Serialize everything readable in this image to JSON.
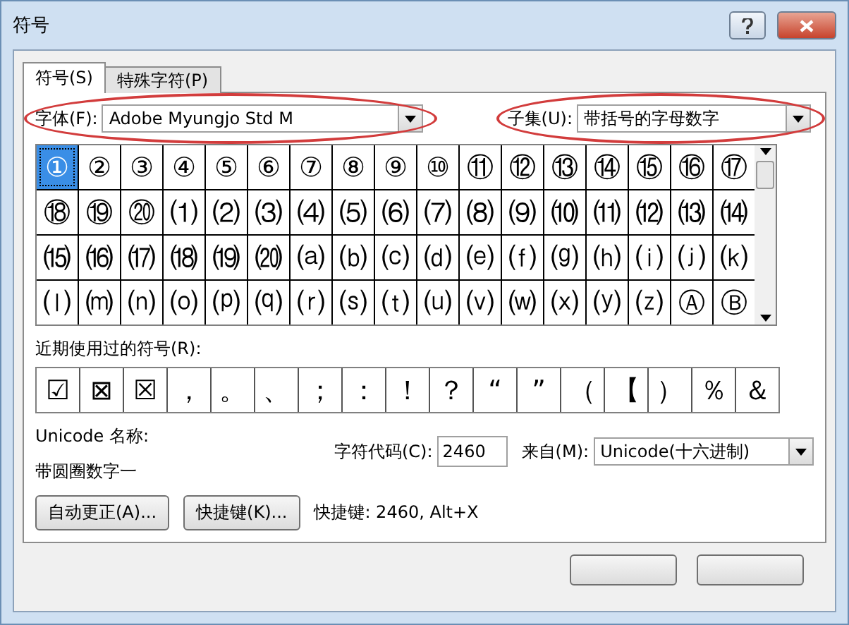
{
  "window": {
    "title": "符号"
  },
  "tabs": [
    {
      "label": "符号(S)",
      "selected": true
    },
    {
      "label": "特殊字符(P)",
      "selected": false
    }
  ],
  "font": {
    "label": "字体(F):",
    "value": "Adobe Myungjo Std M",
    "highlighted": true
  },
  "subset": {
    "label": "子集(U):",
    "value": "带括号的字母数字",
    "highlighted": true
  },
  "symbols": [
    {
      "char": "①",
      "selected": true
    },
    {
      "char": "②",
      "selected": false
    },
    {
      "char": "③",
      "selected": false
    },
    {
      "char": "④",
      "selected": false
    },
    {
      "char": "⑤",
      "selected": false
    },
    {
      "char": "⑥",
      "selected": false
    },
    {
      "char": "⑦",
      "selected": false
    },
    {
      "char": "⑧",
      "selected": false
    },
    {
      "char": "⑨",
      "selected": false
    },
    {
      "char": "⑩",
      "selected": false
    },
    {
      "char": "⑪",
      "selected": false
    },
    {
      "char": "⑫",
      "selected": false
    },
    {
      "char": "⑬",
      "selected": false
    },
    {
      "char": "⑭",
      "selected": false
    },
    {
      "char": "⑮",
      "selected": false
    },
    {
      "char": "⑯",
      "selected": false
    },
    {
      "char": "⑰",
      "selected": false
    },
    {
      "char": "⑱",
      "selected": false
    },
    {
      "char": "⑲",
      "selected": false
    },
    {
      "char": "⑳",
      "selected": false
    },
    {
      "char": "⑴",
      "selected": false
    },
    {
      "char": "⑵",
      "selected": false
    },
    {
      "char": "⑶",
      "selected": false
    },
    {
      "char": "⑷",
      "selected": false
    },
    {
      "char": "⑸",
      "selected": false
    },
    {
      "char": "⑹",
      "selected": false
    },
    {
      "char": "⑺",
      "selected": false
    },
    {
      "char": "⑻",
      "selected": false
    },
    {
      "char": "⑼",
      "selected": false
    },
    {
      "char": "⑽",
      "selected": false
    },
    {
      "char": "⑾",
      "selected": false
    },
    {
      "char": "⑿",
      "selected": false
    },
    {
      "char": "⒀",
      "selected": false
    },
    {
      "char": "⒁",
      "selected": false
    },
    {
      "char": "⒂",
      "selected": false
    },
    {
      "char": "⒃",
      "selected": false
    },
    {
      "char": "⒄",
      "selected": false
    },
    {
      "char": "⒅",
      "selected": false
    },
    {
      "char": "⒆",
      "selected": false
    },
    {
      "char": "⒇",
      "selected": false
    },
    {
      "char": "⒜",
      "selected": false
    },
    {
      "char": "⒝",
      "selected": false
    },
    {
      "char": "⒞",
      "selected": false
    },
    {
      "char": "⒟",
      "selected": false
    },
    {
      "char": "⒠",
      "selected": false
    },
    {
      "char": "⒡",
      "selected": false
    },
    {
      "char": "⒢",
      "selected": false
    },
    {
      "char": "⒣",
      "selected": false
    },
    {
      "char": "⒤",
      "selected": false
    },
    {
      "char": "⒥",
      "selected": false
    },
    {
      "char": "⒦",
      "selected": false
    },
    {
      "char": "⒧",
      "selected": false
    },
    {
      "char": "⒨",
      "selected": false
    },
    {
      "char": "⒩",
      "selected": false
    },
    {
      "char": "⒪",
      "selected": false
    },
    {
      "char": "⒫",
      "selected": false
    },
    {
      "char": "⒬",
      "selected": false
    },
    {
      "char": "⒭",
      "selected": false
    },
    {
      "char": "⒮",
      "selected": false
    },
    {
      "char": "⒯",
      "selected": false
    },
    {
      "char": "⒰",
      "selected": false
    },
    {
      "char": "⒱",
      "selected": false
    },
    {
      "char": "⒲",
      "selected": false
    },
    {
      "char": "⒳",
      "selected": false
    },
    {
      "char": "⒴",
      "selected": false
    },
    {
      "char": "⒵",
      "selected": false
    },
    {
      "char": "Ⓐ",
      "selected": false
    },
    {
      "char": "Ⓑ",
      "selected": false
    }
  ],
  "recent": {
    "label": "近期使用过的符号(R):",
    "symbols": [
      "☑",
      "⊠",
      "☒",
      "，",
      "。",
      "、",
      "；",
      "：",
      "！",
      "？",
      "“",
      "”",
      "（",
      "【",
      "）",
      "％",
      "＆"
    ]
  },
  "unicode_name": {
    "label": "Unicode 名称:",
    "value": "带圆圈数字一"
  },
  "char_code": {
    "label": "字符代码(C):",
    "value": "2460"
  },
  "from": {
    "label": "来自(M):",
    "value": "Unicode(十六进制)"
  },
  "buttons": [
    "自动更正(A)...",
    "快捷键(K)..."
  ],
  "shortcut": "快捷键: 2460, Alt+X"
}
